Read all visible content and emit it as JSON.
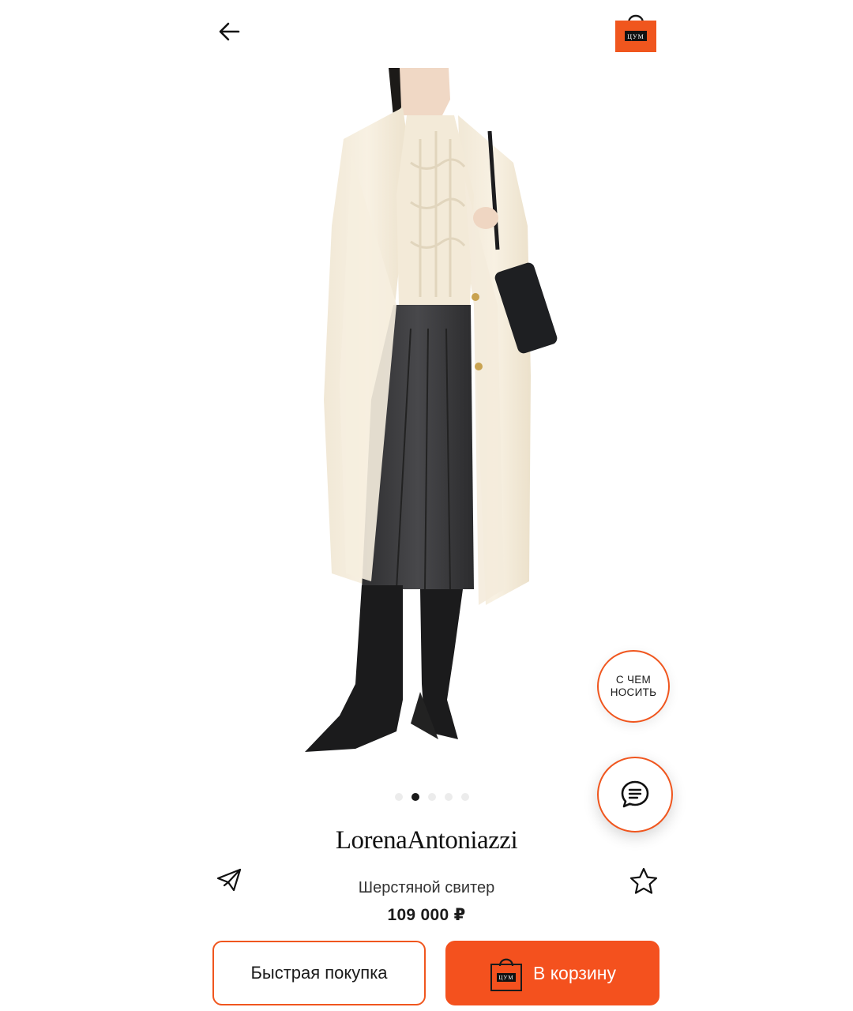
{
  "header": {
    "back_icon": "arrow-left-icon",
    "cart_icon": "tsum-shopping-bag-icon",
    "cart_logo_text": "ЦУМ",
    "accent_color": "#f0561e"
  },
  "gallery": {
    "image_description_icon": "product-photo",
    "total_images": 5,
    "active_index": 1
  },
  "floating": {
    "outfit_label": "С ЧЕМ\nНОСИТЬ",
    "chat_icon": "chat-bubble-icon"
  },
  "product": {
    "brand": "LorenaAntoniazzi",
    "name": "Шерстяной свитер",
    "price": "109 000 ₽",
    "share_icon": "paper-plane-icon",
    "favorite_icon": "star-outline-icon"
  },
  "actions": {
    "quick_buy_label": "Быстрая покупка",
    "add_to_cart_label": "В корзину",
    "cart_button_color": "#f4511e"
  }
}
